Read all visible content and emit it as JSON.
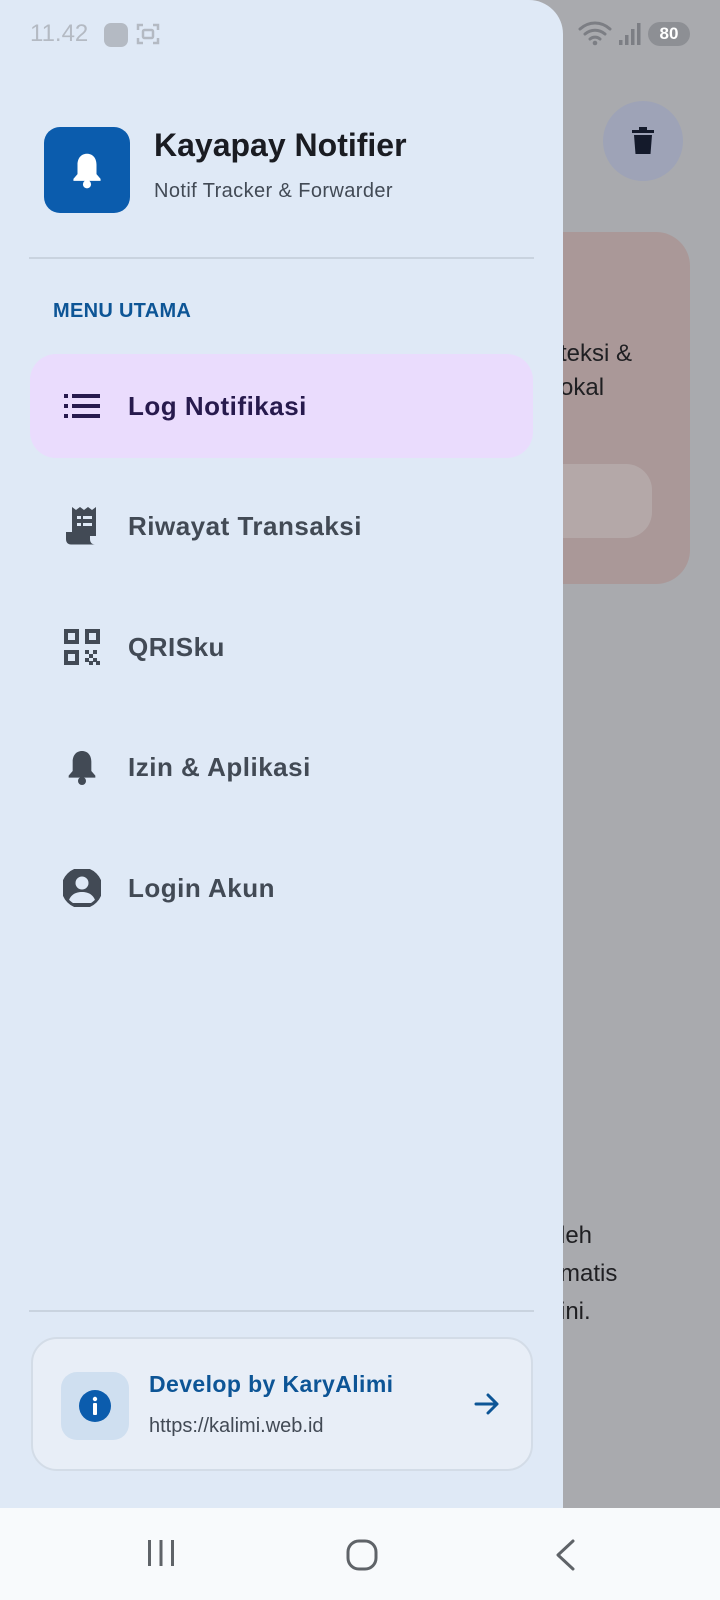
{
  "status_bar": {
    "time": "11.42",
    "battery": "80"
  },
  "background_screen": {
    "delete_icon": "trash-icon",
    "text_lines": [
      "teksi &",
      "okal",
      "leh",
      "matis",
      "ini."
    ]
  },
  "drawer": {
    "app_title": "Kayapay Notifier",
    "app_subtitle": "Notif Tracker & Forwarder",
    "app_icon": "bell-icon",
    "section_title": "MENU UTAMA",
    "items": [
      {
        "label": "Log Notifikasi",
        "icon": "list-icon",
        "active": true
      },
      {
        "label": "Riwayat Transaksi",
        "icon": "receipt-icon",
        "active": false
      },
      {
        "label": "QRISku",
        "icon": "qr-code-icon",
        "active": false
      },
      {
        "label": "Izin & Aplikasi",
        "icon": "bell-icon",
        "active": false
      },
      {
        "label": "Login Akun",
        "icon": "account-circle-icon",
        "active": false
      }
    ],
    "developer": {
      "title": "Develop by KaryAlimi",
      "url": "https://kalimi.web.id",
      "icon": "info-icon",
      "arrow_icon": "arrow-right-icon"
    }
  },
  "colors": {
    "primary": "#0b5cad",
    "drawer_bg": "#dfe9f6",
    "active_item_bg": "#eadcfd",
    "scrim": "#a9aaae"
  }
}
